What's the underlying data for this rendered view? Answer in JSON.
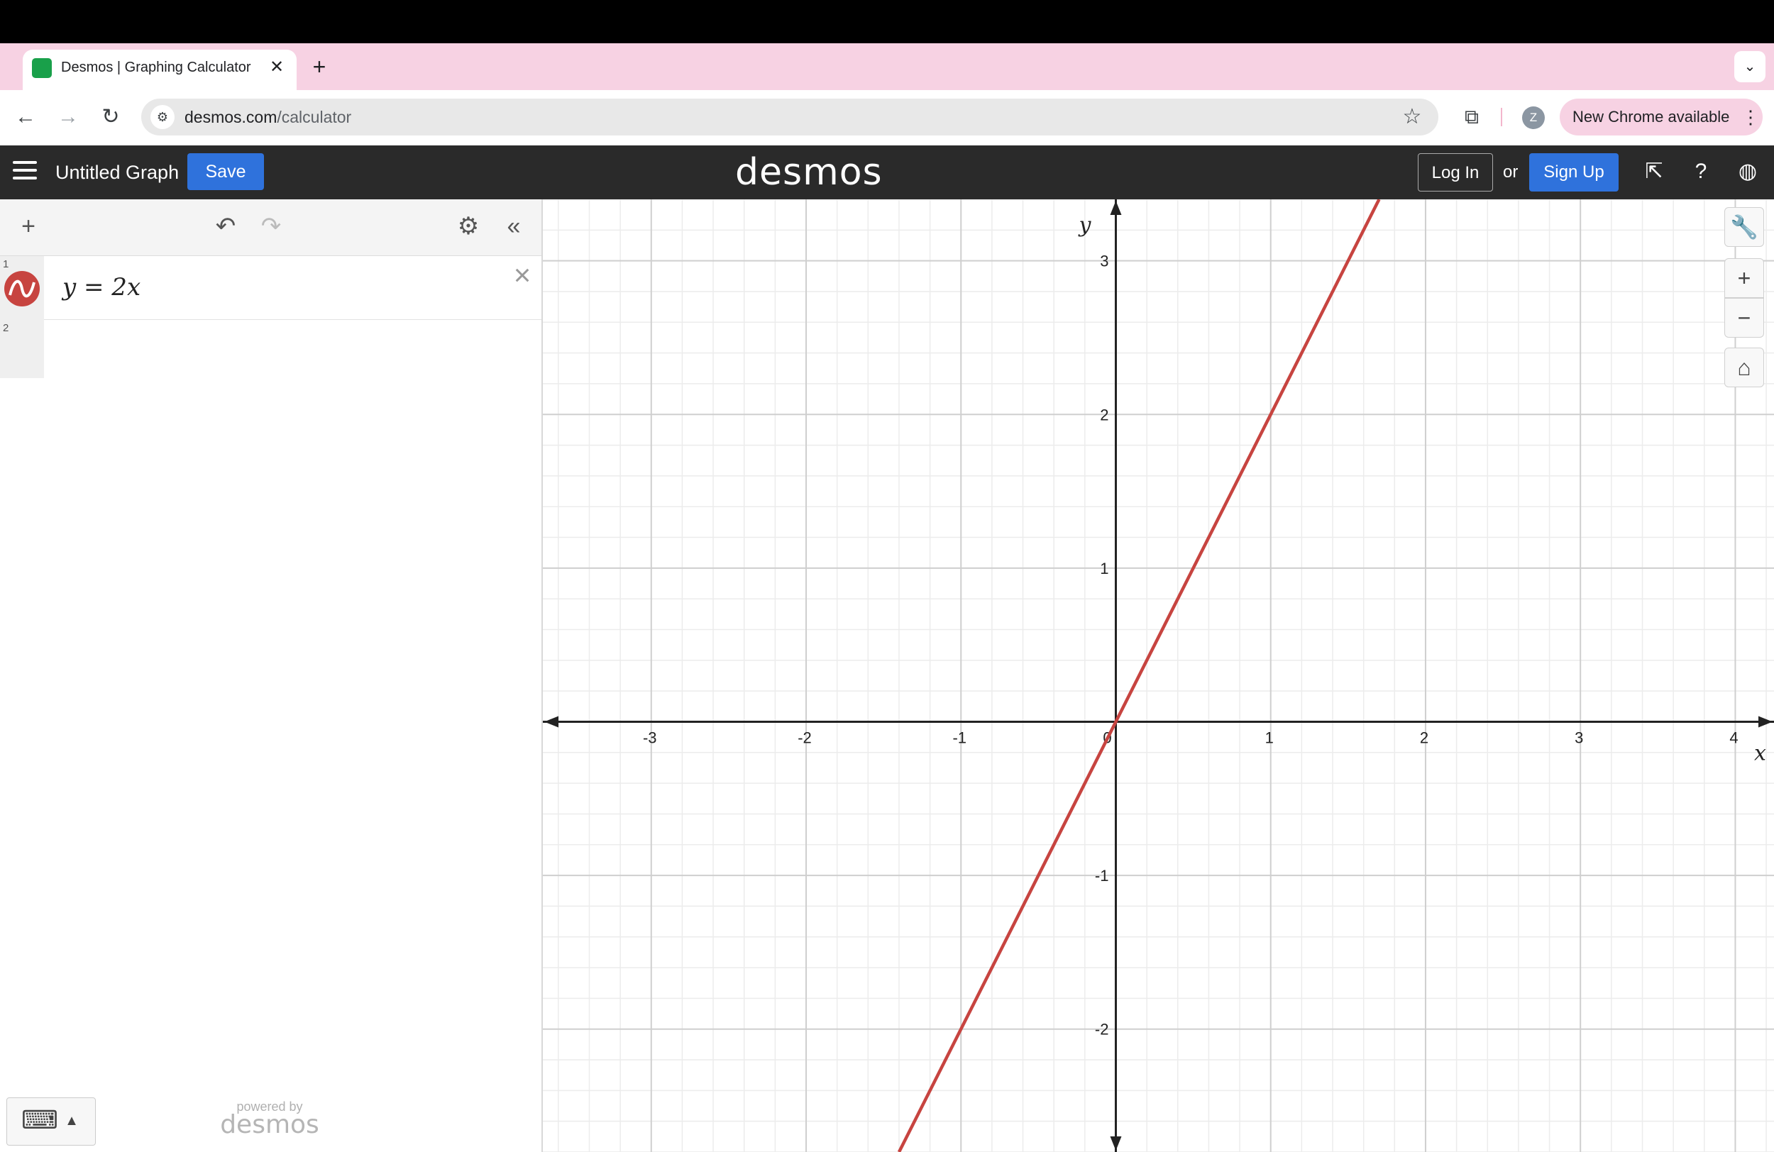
{
  "browser": {
    "tab_title": "Desmos | Graphing Calculator",
    "tab_close": "✕",
    "new_tab": "+",
    "tab_menu": "⌄",
    "url_host": "desmos.com",
    "url_path": "/calculator",
    "profile_initial": "Z",
    "update_label": "New Chrome available",
    "icons": [
      "back-icon",
      "forward-icon",
      "reload-icon",
      "site-info-icon",
      "star-icon",
      "extensions-icon",
      "more-icon"
    ]
  },
  "header": {
    "graph_title": "Untitled Graph",
    "save_label": "Save",
    "logo": "desmos",
    "login_label": "Log In",
    "or_label": "or",
    "signup_label": "Sign Up"
  },
  "expressions": {
    "rows": [
      {
        "number": "1",
        "latex": "y = 2x",
        "color": "#c74440"
      },
      {
        "number": "2",
        "latex": ""
      }
    ]
  },
  "footer": {
    "powered_by": "powered by",
    "powered_logo": "desmos"
  },
  "colors": {
    "accent_blue": "#2f72dc",
    "header_bg": "#2a2a2a",
    "tabstrip_pink": "#f7d2e3",
    "curve_red": "#c74440"
  },
  "chart_data": {
    "type": "line",
    "xlabel": "x",
    "ylabel": "y",
    "xlim": [
      -3.7,
      4.25
    ],
    "ylim": [
      -2.8,
      3.4
    ],
    "grid": true,
    "x_ticks": [
      -3,
      -2,
      -1,
      0,
      1,
      2,
      3,
      4
    ],
    "y_ticks": [
      -2,
      -1,
      1,
      2,
      3
    ],
    "x_tick_labels": [
      "-3",
      "-2",
      "-1",
      "0",
      "1",
      "2",
      "3",
      "4"
    ],
    "y_tick_labels": [
      "-2",
      "-1",
      "1",
      "2",
      "3"
    ],
    "series": [
      {
        "name": "y = 2x",
        "x": [
          -1.4,
          1.7
        ],
        "y": [
          -2.8,
          3.4
        ],
        "color": "#c74440"
      }
    ]
  }
}
